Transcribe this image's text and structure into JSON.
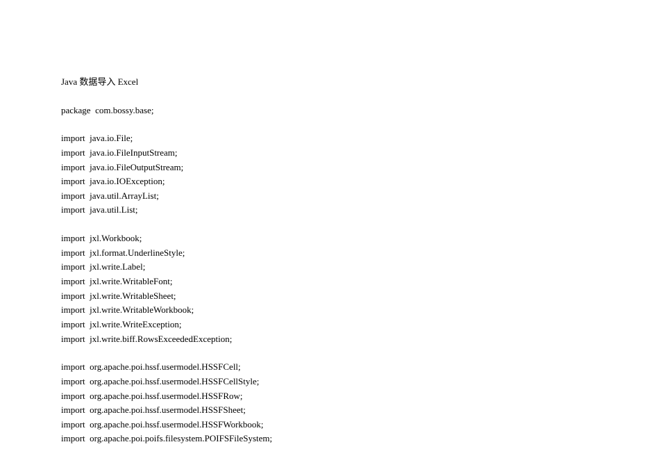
{
  "title": "Java 数据导入 Excel",
  "package_line": "package  com.bossy.base;",
  "group1": [
    "import  java.io.File;",
    "import  java.io.FileInputStream;",
    "import  java.io.FileOutputStream;",
    "import  java.io.IOException;",
    "import  java.util.ArrayList;",
    "import  java.util.List;"
  ],
  "group2": [
    "import  jxl.Workbook;",
    "import  jxl.format.UnderlineStyle;",
    "import  jxl.write.Label;",
    "import  jxl.write.WritableFont;",
    "import  jxl.write.WritableSheet;",
    "import  jxl.write.WritableWorkbook;",
    "import  jxl.write.WriteException;",
    "import  jxl.write.biff.RowsExceededException;"
  ],
  "group3": [
    "import  org.apache.poi.hssf.usermodel.HSSFCell;",
    "import  org.apache.poi.hssf.usermodel.HSSFCellStyle;",
    "import  org.apache.poi.hssf.usermodel.HSSFRow;",
    "import  org.apache.poi.hssf.usermodel.HSSFSheet;",
    "import  org.apache.poi.hssf.usermodel.HSSFWorkbook;",
    "import  org.apache.poi.poifs.filesystem.POIFSFileSystem;"
  ]
}
